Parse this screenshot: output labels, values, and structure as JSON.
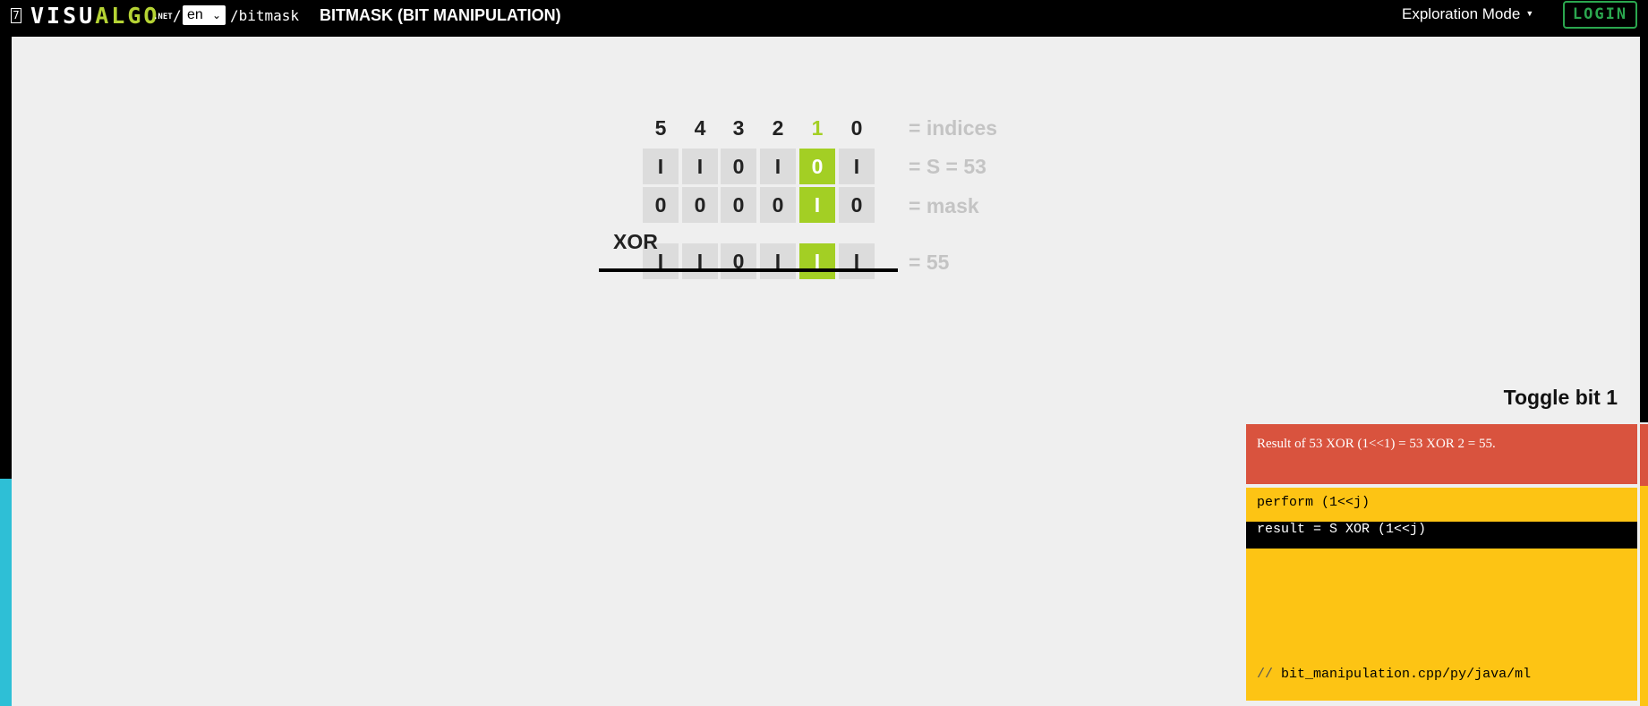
{
  "topbar": {
    "logo_box": "7",
    "logo_part1": "VISU",
    "logo_part2": "ALGO",
    "logo_net": ".NET",
    "slash": "/",
    "language": "en",
    "path": "/bitmask",
    "title": "BITMASK (BIT MANIPULATION)",
    "mode": "Exploration Mode",
    "login": "LOGIN"
  },
  "bits": {
    "indices": [
      "5",
      "4",
      "3",
      "2",
      "1",
      "0"
    ],
    "highlight_index": 4,
    "s_row": [
      "I",
      "I",
      "0",
      "I",
      "0",
      "I"
    ],
    "mask_row": [
      "0",
      "0",
      "0",
      "0",
      "I",
      "0"
    ],
    "result_row": [
      "I",
      "I",
      "0",
      "I",
      "I",
      "I"
    ],
    "indices_label": "= indices",
    "s_label": "= S = 53",
    "mask_label": "= mask",
    "result_label": "= 55",
    "operator": "XOR"
  },
  "panel": {
    "title": "Toggle bit 1",
    "status": "Result of 53 XOR (1<<1) = 53 XOR 2 = 55.",
    "code_lines": [
      "perform (1<<j)",
      "result = S XOR (1<<j)"
    ],
    "active_line": 1,
    "footer_comment": "//",
    "footer_file": "bit_manipulation.cpp/py/java/ml"
  },
  "colors": {
    "highlight": "#a3cf24",
    "status_bg": "#d9533e",
    "code_bg": "#fdc414",
    "login": "#2ba74f"
  }
}
